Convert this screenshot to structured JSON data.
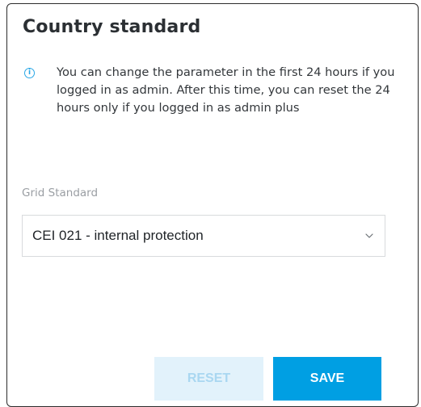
{
  "dialog": {
    "title": "Country standard",
    "info_icon": "info-circle-icon",
    "info_text": "You can change the parameter in the first 24 hours if you logged in as admin. After this time, you can reset the 24 hours only if you logged in as admin plus"
  },
  "grid_standard": {
    "label": "Grid Standard",
    "selected_value": "CEI 021 - internal protection",
    "dropdown_icon": "chevron-down-icon"
  },
  "actions": {
    "reset_label": "RESET",
    "reset_disabled": true,
    "save_label": "SAVE"
  },
  "colors": {
    "accent": "#009fe3",
    "accent_disabled_bg": "#e2f2fb",
    "accent_disabled_text": "#a9d7f1",
    "info_icon": "#2aa7e6"
  }
}
